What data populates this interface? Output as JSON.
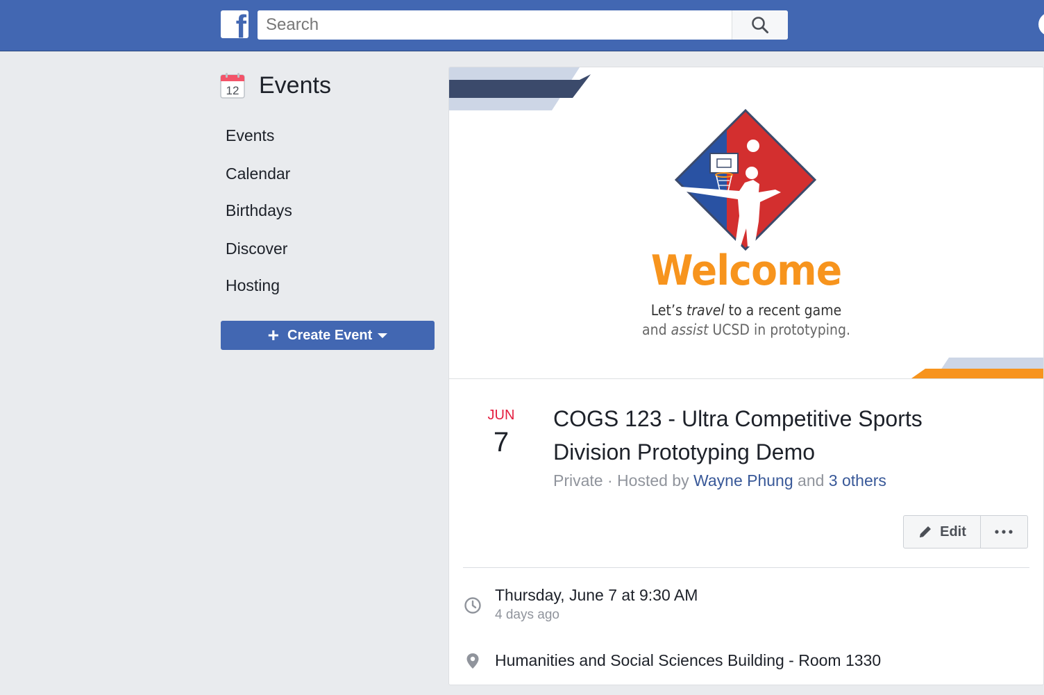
{
  "search": {
    "placeholder": "Search"
  },
  "nav": {
    "title": "Events",
    "calendar_icon_day": "12",
    "items": [
      {
        "label": "Events"
      },
      {
        "label": "Calendar"
      },
      {
        "label": "Birthdays"
      },
      {
        "label": "Discover"
      },
      {
        "label": "Hosting"
      }
    ],
    "create_button_label": "Create Event"
  },
  "cover": {
    "welcome": "Welcome",
    "tagline_line1_a": "Let’s ",
    "tagline_line1_b": "travel",
    "tagline_line1_c": " to a recent game",
    "tagline_line2_a": "and ",
    "tagline_line2_b": "assist",
    "tagline_line2_c": " UCSD in prototyping."
  },
  "event": {
    "month": "JUN",
    "day": "7",
    "title": "COGS 123 - Ultra Competitive Sports Division Prototyping Demo",
    "privacy": "Private",
    "separator": " · ",
    "hosted_by": "Hosted by ",
    "host_name": "Wayne Phung",
    "and_text": " and ",
    "others": "3 others",
    "edit_label": "Edit",
    "more_label": "···",
    "time_main": "Thursday, June 7 at 9:30 AM",
    "time_sub": "4 days ago",
    "location": "Humanities and Social Sciences Building - Room 1330"
  },
  "colors": {
    "brand_blue": "#4267b2",
    "link_blue": "#385898",
    "date_red": "#e41e3f",
    "welcome_orange": "#f7941d",
    "logo_red": "#d32f2f",
    "logo_blue": "#2952a3"
  },
  "icons": {
    "logo": "facebook-logo",
    "search": "search-icon",
    "calendar": "calendar-icon",
    "plus": "plus-icon",
    "caret": "caret-down-icon",
    "pencil": "pencil-icon",
    "more": "more-icon",
    "clock": "clock-icon",
    "pin": "location-pin-icon"
  }
}
